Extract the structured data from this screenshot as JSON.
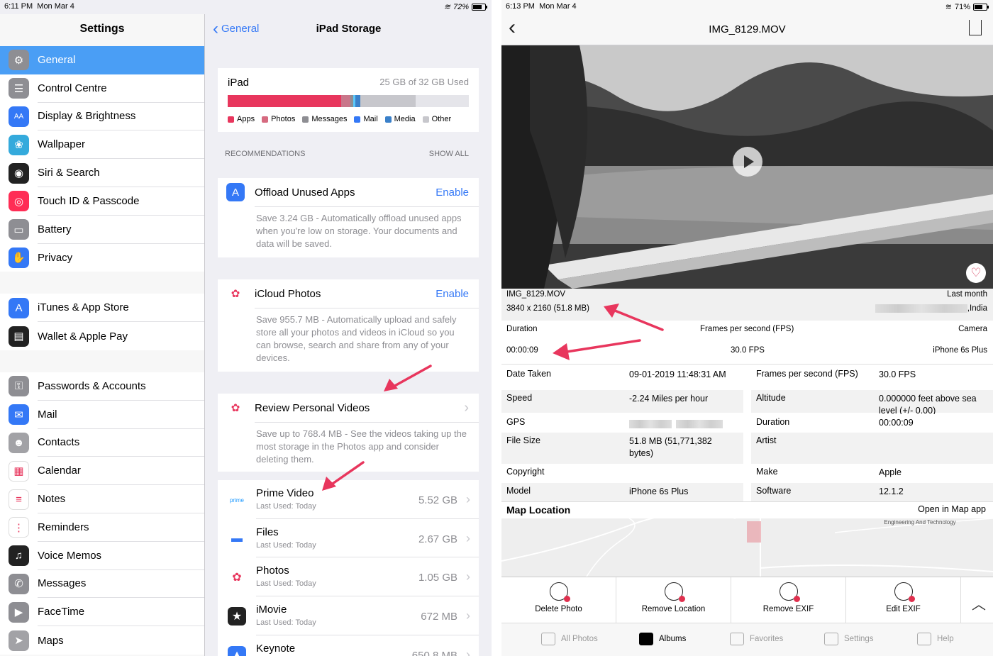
{
  "left": {
    "status": {
      "time": "6:11 PM",
      "date": "Mon Mar 4",
      "battery": "72%",
      "battery_level": 0.72
    },
    "settings": {
      "title": "Settings",
      "groups": [
        [
          {
            "label": "General",
            "icon": "gear-icon",
            "color": "#8e8e93",
            "glyph": "⚙",
            "active": true
          },
          {
            "label": "Control Centre",
            "icon": "toggle-icon",
            "color": "#8e8e93",
            "glyph": "☰"
          },
          {
            "label": "Display & Brightness",
            "icon": "text-size-icon",
            "color": "#3478f6",
            "glyph": "AA"
          },
          {
            "label": "Wallpaper",
            "icon": "flower-icon",
            "color": "#34aadc",
            "glyph": "❀"
          },
          {
            "label": "Siri & Search",
            "icon": "siri-icon",
            "color": "#222222",
            "glyph": "◉"
          },
          {
            "label": "Touch ID & Passcode",
            "icon": "fingerprint-icon",
            "color": "#ff2d55",
            "glyph": "◎"
          },
          {
            "label": "Battery",
            "icon": "battery-icon",
            "color": "#8e8e93",
            "glyph": "▭"
          },
          {
            "label": "Privacy",
            "icon": "hand-icon",
            "color": "#3478f6",
            "glyph": "✋"
          }
        ],
        [
          {
            "label": "iTunes & App Store",
            "icon": "app-store-icon",
            "color": "#3478f6",
            "glyph": "A"
          },
          {
            "label": "Wallet & Apple Pay",
            "icon": "wallet-icon",
            "color": "#222222",
            "glyph": "▤"
          }
        ],
        [
          {
            "label": "Passwords & Accounts",
            "icon": "key-icon",
            "color": "#8e8e93",
            "glyph": "⚿"
          },
          {
            "label": "Mail",
            "icon": "mail-icon",
            "color": "#3478f6",
            "glyph": "✉"
          },
          {
            "label": "Contacts",
            "icon": "contacts-icon",
            "color": "#a2a2a6",
            "glyph": "☻"
          },
          {
            "label": "Calendar",
            "icon": "calendar-icon",
            "color": "#ffffff",
            "glyph": "▦",
            "dark": true
          },
          {
            "label": "Notes",
            "icon": "notes-icon",
            "color": "#ffffff",
            "glyph": "≡",
            "dark": true
          },
          {
            "label": "Reminders",
            "icon": "reminders-icon",
            "color": "#ffffff",
            "glyph": "⋮",
            "dark": true
          },
          {
            "label": "Voice Memos",
            "icon": "voice-memos-icon",
            "color": "#222222",
            "glyph": "♫"
          },
          {
            "label": "Messages",
            "icon": "messages-icon",
            "color": "#8e8e93",
            "glyph": "✆"
          },
          {
            "label": "FaceTime",
            "icon": "facetime-icon",
            "color": "#8e8e93",
            "glyph": "▶"
          },
          {
            "label": "Maps",
            "icon": "maps-icon",
            "color": "#a2a2a6",
            "glyph": "➤"
          }
        ]
      ]
    },
    "storage": {
      "back_label": "General",
      "title": "iPad Storage",
      "device": "iPad",
      "used": "25 GB of 32 GB Used",
      "usage_segments": [
        {
          "name": "Apps",
          "fraction": 0.47,
          "color": "#e8365d"
        },
        {
          "name": "Photos",
          "fraction": 0.04,
          "color": "#c9768a"
        },
        {
          "name": "Messages",
          "fraction": 0.01,
          "color": "#8e8e93"
        },
        {
          "name": "Mail",
          "fraction": 0.01,
          "color": "#5ac8fa"
        },
        {
          "name": "Media",
          "fraction": 0.02,
          "color": "#3a80c9"
        },
        {
          "name": "Other",
          "fraction": 0.23,
          "color": "#c7c7cc"
        }
      ],
      "legend": [
        {
          "label": "Apps",
          "color": "#e8365d"
        },
        {
          "label": "Photos",
          "color": "#d66a80"
        },
        {
          "label": "Messages",
          "color": "#8e8e93"
        },
        {
          "label": "Mail",
          "color": "#3478f6"
        },
        {
          "label": "Media",
          "color": "#3a80c9"
        },
        {
          "label": "Other",
          "color": "#c7c7cc"
        }
      ],
      "recommendations_label": "RECOMMENDATIONS",
      "show_all": "SHOW ALL",
      "recommendations": [
        {
          "title": "Offload Unused Apps",
          "action": "Enable",
          "icon": "app-store-icon",
          "desc": "Save 3.24 GB - Automatically offload unused apps when you're low on storage. Your documents and data will be saved."
        },
        {
          "title": "iCloud Photos",
          "action": "Enable",
          "icon": "photos-icon",
          "desc": "Save 955.7 MB - Automatically upload and safely store all your photos and videos in iCloud so you can browse, search and share from any of your devices."
        },
        {
          "title": "Review Personal Videos",
          "action": "›",
          "icon": "photos-icon",
          "desc": "Save up to 768.4 MB - See the videos taking up the most storage in the Photos app and consider deleting them."
        }
      ],
      "apps": [
        {
          "name": "Prime Video",
          "last_used": "Last Used: Today",
          "size": "5.52 GB",
          "icon": "prime-video-icon",
          "glyph": "prime"
        },
        {
          "name": "Files",
          "last_used": "Last Used: Today",
          "size": "2.67 GB",
          "icon": "files-icon",
          "glyph": "▬"
        },
        {
          "name": "Photos",
          "last_used": "Last Used: Today",
          "size": "1.05 GB",
          "icon": "photos-icon",
          "glyph": "✿"
        },
        {
          "name": "iMovie",
          "last_used": "Last Used: Today",
          "size": "672 MB",
          "icon": "imovie-icon",
          "glyph": "★"
        },
        {
          "name": "Keynote",
          "last_used": "",
          "size": "650.8 MB",
          "icon": "keynote-icon",
          "glyph": "▲"
        }
      ]
    }
  },
  "right": {
    "status": {
      "time": "6:13 PM",
      "date": "Mon Mar 4",
      "battery": "71%",
      "battery_level": 0.71
    },
    "title": "IMG_8129.MOV",
    "media": {
      "filename": "IMG_8129.MOV",
      "resolution": "3840 x 2160 (51.8 MB)",
      "when": "Last month",
      "location_suffix": ",India"
    },
    "summary": {
      "duration_label": "Duration",
      "duration": "00:00:09",
      "fps_label": "Frames per second (FPS)",
      "fps": "30.0 FPS",
      "camera_label": "Camera",
      "camera": "iPhone 6s Plus"
    },
    "exif_left": [
      {
        "k": "Date Taken",
        "v": "09-01-2019 11:48:31 AM"
      },
      {
        "k": "Speed",
        "v": "-2.24 Miles per hour"
      },
      {
        "k": "GPS",
        "v": ""
      },
      {
        "k": "File Size",
        "v": "51.8 MB (51,771,382 bytes)"
      },
      {
        "k": "Copyright",
        "v": ""
      },
      {
        "k": "Model",
        "v": "iPhone 6s Plus"
      }
    ],
    "exif_right": [
      {
        "k": "Frames per second (FPS)",
        "v": "30.0 FPS"
      },
      {
        "k": "Altitude",
        "v": "0.000000 feet above sea level (+/- 0.00)"
      },
      {
        "k": "Duration",
        "v": "00:00:09"
      },
      {
        "k": "Artist",
        "v": ""
      },
      {
        "k": "Make",
        "v": "Apple"
      },
      {
        "k": "Software",
        "v": "12.1.2"
      }
    ],
    "map": {
      "title": "Map Location",
      "open": "Open in Map app",
      "label": "Engineering And Technology"
    },
    "actions": [
      {
        "label": "Delete Photo",
        "icon": "delete-photo-icon"
      },
      {
        "label": "Remove Location",
        "icon": "remove-location-icon"
      },
      {
        "label": "Remove EXIF",
        "icon": "remove-exif-icon"
      },
      {
        "label": "Edit EXIF",
        "icon": "edit-exif-icon"
      }
    ],
    "tabs": [
      {
        "label": "All Photos",
        "icon": "all-photos-icon",
        "selected": false
      },
      {
        "label": "Albums",
        "icon": "albums-icon",
        "selected": true
      },
      {
        "label": "Favorites",
        "icon": "favorites-icon",
        "selected": false
      },
      {
        "label": "Settings",
        "icon": "settings-icon",
        "selected": false
      },
      {
        "label": "Help",
        "icon": "help-icon",
        "selected": false
      }
    ]
  }
}
